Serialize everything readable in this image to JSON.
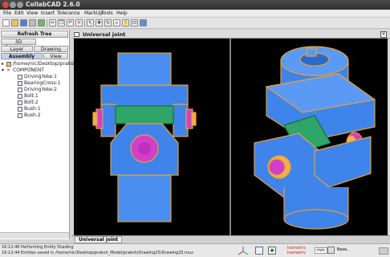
{
  "app": {
    "title": "CollabCAD 2.6.0"
  },
  "menu": [
    "File",
    "Edit",
    "View",
    "Insert",
    "Tolerance",
    "MarkUp",
    "Tools",
    "Help"
  ],
  "toolbar": {
    "icons": [
      "new-icon",
      "open-icon",
      "save-icon",
      "print-icon",
      "export-icon",
      "cut-icon",
      "copy-icon",
      "paste-icon",
      "undo-icon",
      "redo-icon",
      "delete-icon",
      "select-icon",
      "move-icon",
      "rotate-icon",
      "zoom-icon",
      "pan-icon",
      "fit-icon",
      "shade-icon"
    ]
  },
  "left_panel": {
    "refresh_label": "Refresh Tree",
    "constraints_label": "3D Constraints",
    "tabs_row1": [
      "Layer",
      "Drawing"
    ],
    "tabs_row2": [
      "Assembly",
      "View"
    ],
    "tree": {
      "root_path": "/home/nic/Desktop/praksh",
      "component_label": "COMPONENT",
      "children": [
        "DrivingYoke:1",
        "BearingCross:1",
        "DrivingYoke:2",
        "Bolt:1",
        "Bolt:2",
        "Bush:1",
        "Bush:2"
      ]
    }
  },
  "viewport": {
    "title": "Universal joint",
    "tab_label": "Universal joint"
  },
  "status": {
    "log_lines": [
      "16:12:46 Performing Entity Shading",
      "16:12:44 Entities saved in /home/nic/Desktop/praksh_Model/praksh/Drawing25/Drawing25.muz"
    ],
    "view_lines": [
      "Isometric",
      "Isometric"
    ],
    "units": "mm",
    "mode_label": "Base..",
    "accent_red": "#cc2222"
  }
}
